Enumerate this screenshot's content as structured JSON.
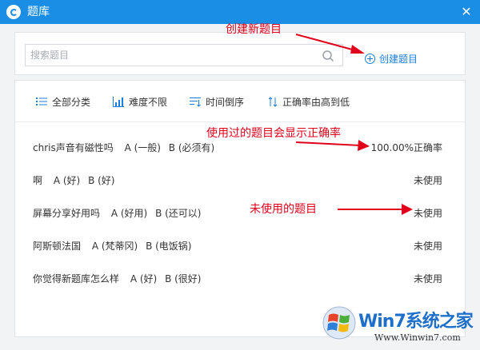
{
  "window": {
    "title": "题库",
    "close_glyph": "✕"
  },
  "search": {
    "placeholder": "搜索题目",
    "value": ""
  },
  "create_button": {
    "label": "创建题目"
  },
  "filters": [
    {
      "icon": "list-icon",
      "label": "全部分类"
    },
    {
      "icon": "bar-chart-icon",
      "label": "难度不限"
    },
    {
      "icon": "sort-time-icon",
      "label": "时间倒序"
    },
    {
      "icon": "sort-rate-icon",
      "label": "正确率由高到低"
    }
  ],
  "questions": [
    {
      "text": "chris声音有磁性吗",
      "option_a": "A (一般)",
      "option_b": "B (必须有)",
      "status": "100.00%正确率"
    },
    {
      "text": "啊",
      "option_a": "A (好)",
      "option_b": "B (好)",
      "status": "未使用"
    },
    {
      "text": "屏幕分享好用吗",
      "option_a": "A (好用)",
      "option_b": "B (还可以)",
      "status": "未使用"
    },
    {
      "text": "阿斯顿法国",
      "option_a": "A (梵蒂冈)",
      "option_b": "B (电饭锅)",
      "status": "未使用"
    },
    {
      "text": "你觉得新题库怎么样",
      "option_a": "A (好)",
      "option_b": "B (很好)",
      "status": "未使用"
    }
  ],
  "annotations": {
    "create": "创建新题目",
    "used": "使用过的题目会显示正确率",
    "unused": "未使用的题目"
  },
  "watermark": {
    "title": "Win7系统之家",
    "url": "Www.Winwin7.com"
  },
  "colors": {
    "titlebar": "#1a8de4",
    "accent": "#1a7de0",
    "annotation": "#e0001b"
  }
}
